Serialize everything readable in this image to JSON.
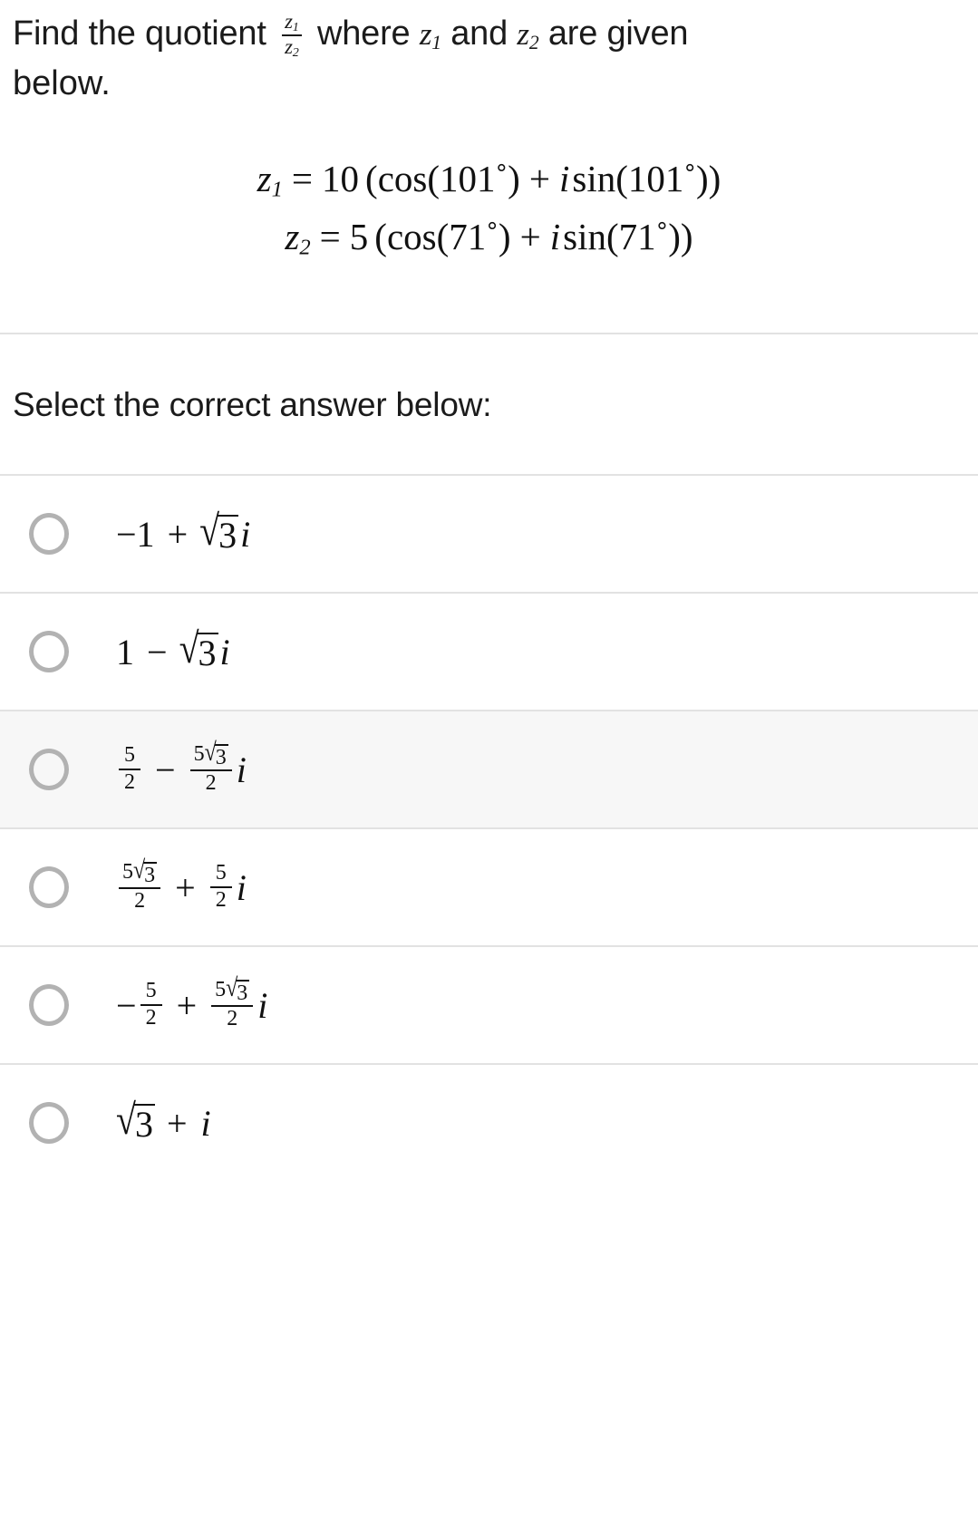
{
  "question": {
    "text_before_fraction": "Find the quotient",
    "fraction": {
      "numerator": "z",
      "numerator_sub": "1",
      "denominator": "z",
      "denominator_sub": "2"
    },
    "text_middle": "where",
    "var1": "z",
    "var1_sub": "1",
    "text_and": "and",
    "var2": "z",
    "var2_sub": "2",
    "text_after": "are given",
    "line2": "below."
  },
  "equations": [
    {
      "lhs_var": "z",
      "lhs_sub": "1",
      "equals": "=",
      "modulus": "10",
      "open": "(",
      "cos": "cos",
      "angle_open": "(",
      "angle": "101˚",
      "angle_close": ")",
      "plus": "+",
      "imag": "i",
      "sin": "sin",
      "close": "))"
    },
    {
      "lhs_var": "z",
      "lhs_sub": "2",
      "equals": "=",
      "modulus": "5",
      "open": "(",
      "cos": "cos",
      "angle_open": "(",
      "angle": "71˚",
      "angle_close": ")",
      "plus": "+",
      "imag": "i",
      "sin": "sin",
      "close": "))"
    }
  ],
  "select_label": "Select the correct answer below:",
  "options": [
    {
      "id": "option-1",
      "kind": "simple",
      "latex": "-1 + \\sqrt{3}i",
      "sign": "−1",
      "operator": "+",
      "radicand": "3",
      "imaginary": "i",
      "selected": false,
      "highlighted": false
    },
    {
      "id": "option-2",
      "kind": "simple",
      "latex": "1 - \\sqrt{3}i",
      "sign": "1",
      "operator": "−",
      "radicand": "3",
      "imaginary": "i",
      "selected": false,
      "highlighted": false
    },
    {
      "id": "option-3",
      "kind": "frac-minus-fracradical",
      "latex": "\\frac{5}{2} - \\frac{5\\sqrt{3}}{2}i",
      "first_num": "5",
      "first_den": "2",
      "operator": "−",
      "second_num_coeff": "5",
      "second_num_radicand": "3",
      "second_den": "2",
      "imaginary": "i",
      "selected": false,
      "highlighted": true
    },
    {
      "id": "option-4",
      "kind": "fracradical-plus-frac",
      "latex": "\\frac{5\\sqrt{3}}{2} + \\frac{5}{2}i",
      "first_num_coeff": "5",
      "first_num_radicand": "3",
      "first_den": "2",
      "operator": "+",
      "second_num": "5",
      "second_den": "2",
      "imaginary": "i",
      "selected": false,
      "highlighted": false
    },
    {
      "id": "option-5",
      "kind": "negfrac-plus-fracradical",
      "latex": "-\\frac{5}{2} + \\frac{5\\sqrt{3}}{2}i",
      "leading_sign": "−",
      "first_num": "5",
      "first_den": "2",
      "operator": "+",
      "second_num_coeff": "5",
      "second_num_radicand": "3",
      "second_den": "2",
      "imaginary": "i",
      "selected": false,
      "highlighted": false
    },
    {
      "id": "option-6",
      "kind": "radical-plus-i",
      "latex": "\\sqrt{3} + i",
      "radicand": "3",
      "operator": "+",
      "imaginary": "i",
      "selected": false,
      "highlighted": false
    }
  ],
  "colors": {
    "background": "#ffffff",
    "text": "#1b1b1b",
    "divider": "#e2e2e2",
    "radio_border": "#b2b2b2",
    "row_highlight": "#f7f7f7"
  },
  "symbols": {
    "radical": "√",
    "degree": "˚"
  }
}
